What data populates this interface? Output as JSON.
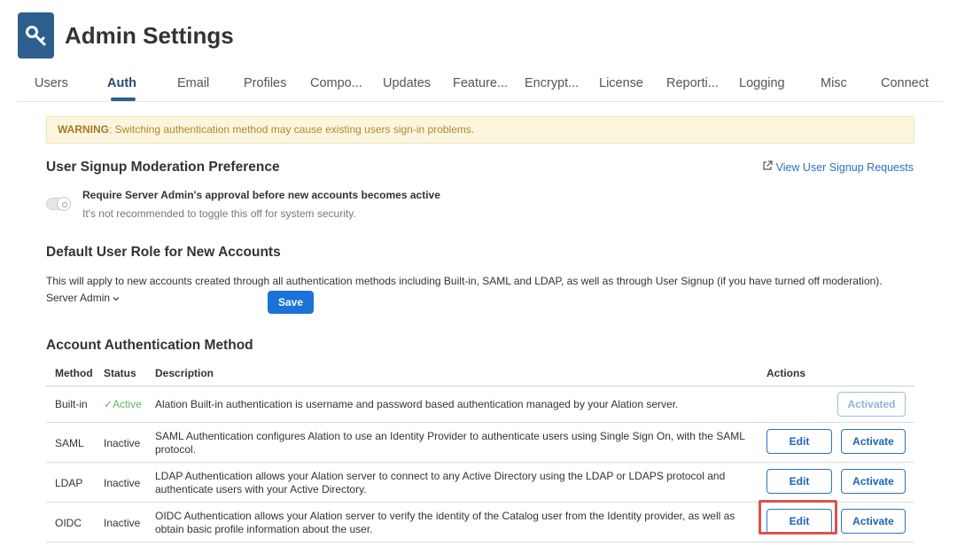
{
  "header": {
    "title": "Admin Settings",
    "icon": "key-icon"
  },
  "tabs": [
    "Users",
    "Auth",
    "Email",
    "Profiles",
    "Compo...",
    "Updates",
    "Feature...",
    "Encrypt...",
    "License",
    "Reporti...",
    "Logging",
    "Misc",
    "Connect"
  ],
  "active_tab": "Auth",
  "warning": {
    "label": "WARNING",
    "text": ": Switching authentication method may cause existing users sign-in problems."
  },
  "signup": {
    "title": "User Signup Moderation Preference",
    "link": "View User Signup Requests",
    "toggle_label": "Require Server Admin's approval before new accounts becomes active",
    "toggle_sub": "It's not recommended to toggle this off for system security."
  },
  "default_role": {
    "title": "Default User Role for New Accounts",
    "description": "This will apply to new accounts created through all authentication methods including Built-in, SAML and LDAP, as well as through User Signup (if you have turned off moderation).",
    "selected": "Server Admin",
    "save": "Save"
  },
  "auth": {
    "title": "Account Authentication Method",
    "columns": {
      "method": "Method",
      "status": "Status",
      "description": "Description",
      "actions": "Actions"
    },
    "rows": [
      {
        "method": "Built-in",
        "status": "Active",
        "description": "Alation Built-in authentication is username and password based authentication managed by your Alation server.",
        "action": "Activated"
      },
      {
        "method": "SAML",
        "status": "Inactive",
        "description": "SAML Authentication configures Alation to use an Identity Provider to authenticate users using Single Sign On, with the SAML protocol.",
        "edit": "Edit",
        "activate": "Activate"
      },
      {
        "method": "LDAP",
        "status": "Inactive",
        "description": "LDAP Authentication allows your Alation server to connect to any Active Directory using the LDAP or LDAPS protocol and authenticate users with your Active Directory.",
        "edit": "Edit",
        "activate": "Activate"
      },
      {
        "method": "OIDC",
        "status": "Inactive",
        "description": "OIDC Authentication allows your Alation server to verify the identity of the Catalog user from the Identity provider, as well as obtain basic profile information about the user.",
        "edit": "Edit",
        "activate": "Activate"
      }
    ]
  },
  "colors": {
    "accent": "#1b72d8",
    "brand": "#2c5f8d",
    "active_status": "#5cb85c",
    "highlight": "#d9534f"
  }
}
